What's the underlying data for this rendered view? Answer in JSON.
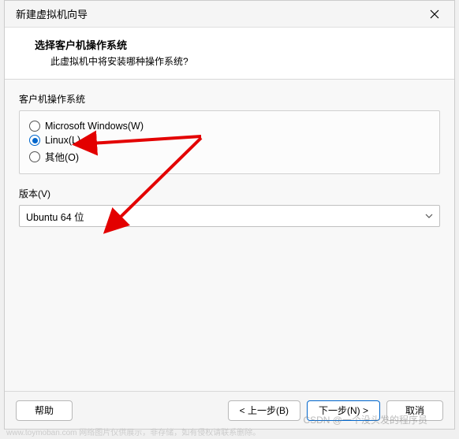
{
  "titlebar": {
    "title": "新建虚拟机向导"
  },
  "header": {
    "title": "选择客户机操作系统",
    "subtitle": "此虚拟机中将安装哪种操作系统?"
  },
  "os_group": {
    "label": "客户机操作系统",
    "options": [
      {
        "label": "Microsoft Windows(W)",
        "selected": false
      },
      {
        "label": "Linux(L)",
        "selected": true
      },
      {
        "label": "其他(O)",
        "selected": false
      }
    ]
  },
  "version_group": {
    "label": "版本(V)",
    "selected": "Ubuntu 64 位"
  },
  "buttons": {
    "help": "帮助",
    "back": "< 上一步(B)",
    "next": "下一步(N) >",
    "cancel": "取消"
  },
  "watermark": "www.toymoban.com 网络图片仅供展示，非存储，如有侵权请联系删除。",
  "watermark2": "CSDN @一个没头发的程序员"
}
